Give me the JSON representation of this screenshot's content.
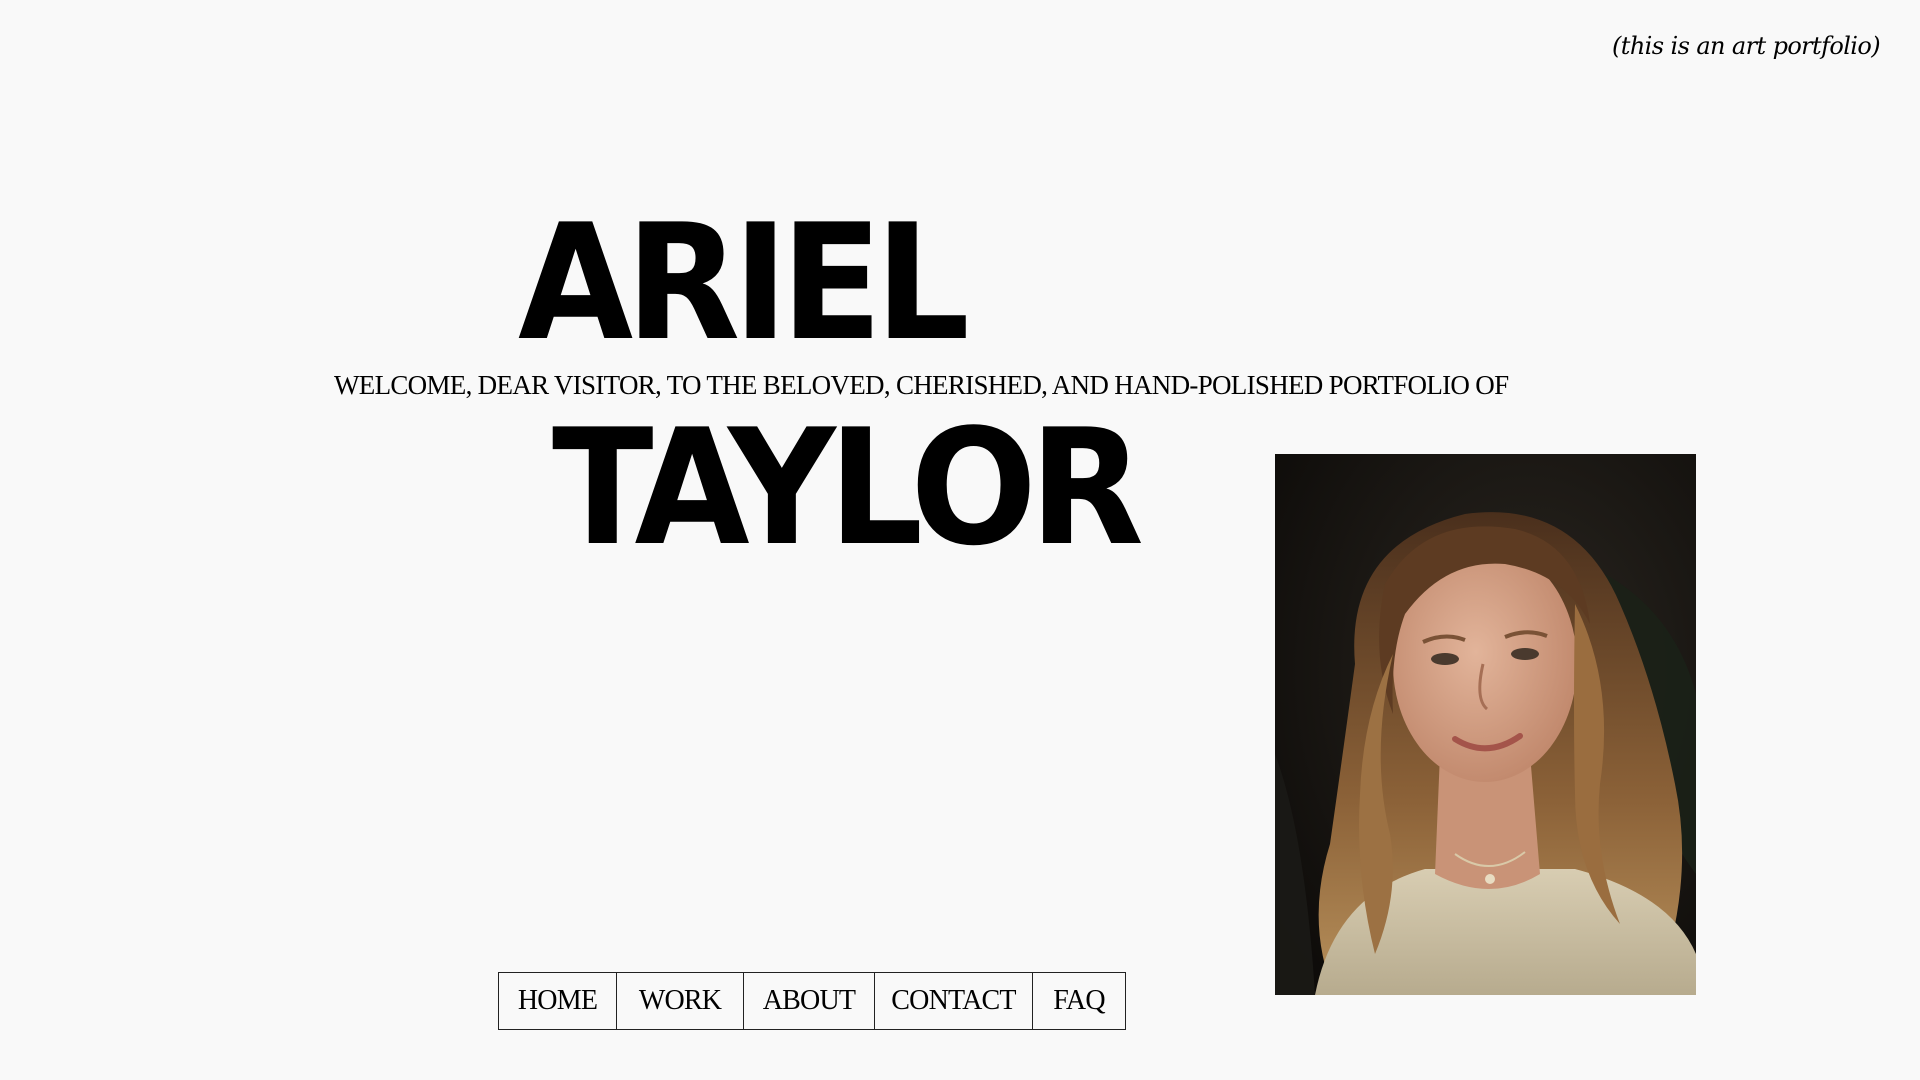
{
  "header": {
    "tagline": "(this is an art portfolio)"
  },
  "hero": {
    "first_name": "ARIEL",
    "welcome": "WELCOME, DEAR VISITOR, TO THE BELOVED, CHERISHED, AND HAND-POLISHED PORTFOLIO OF",
    "last_name": "TAYLOR"
  },
  "portrait": {
    "alt": "Portrait photo of a smiling woman with long curly hair"
  },
  "nav": {
    "items": [
      {
        "label": "HOME"
      },
      {
        "label": "WORK"
      },
      {
        "label": "ABOUT"
      },
      {
        "label": "CONTACT"
      },
      {
        "label": "FAQ"
      }
    ]
  },
  "colors": {
    "background": "#f9f9f9",
    "text": "#000000",
    "border": "#222222"
  }
}
